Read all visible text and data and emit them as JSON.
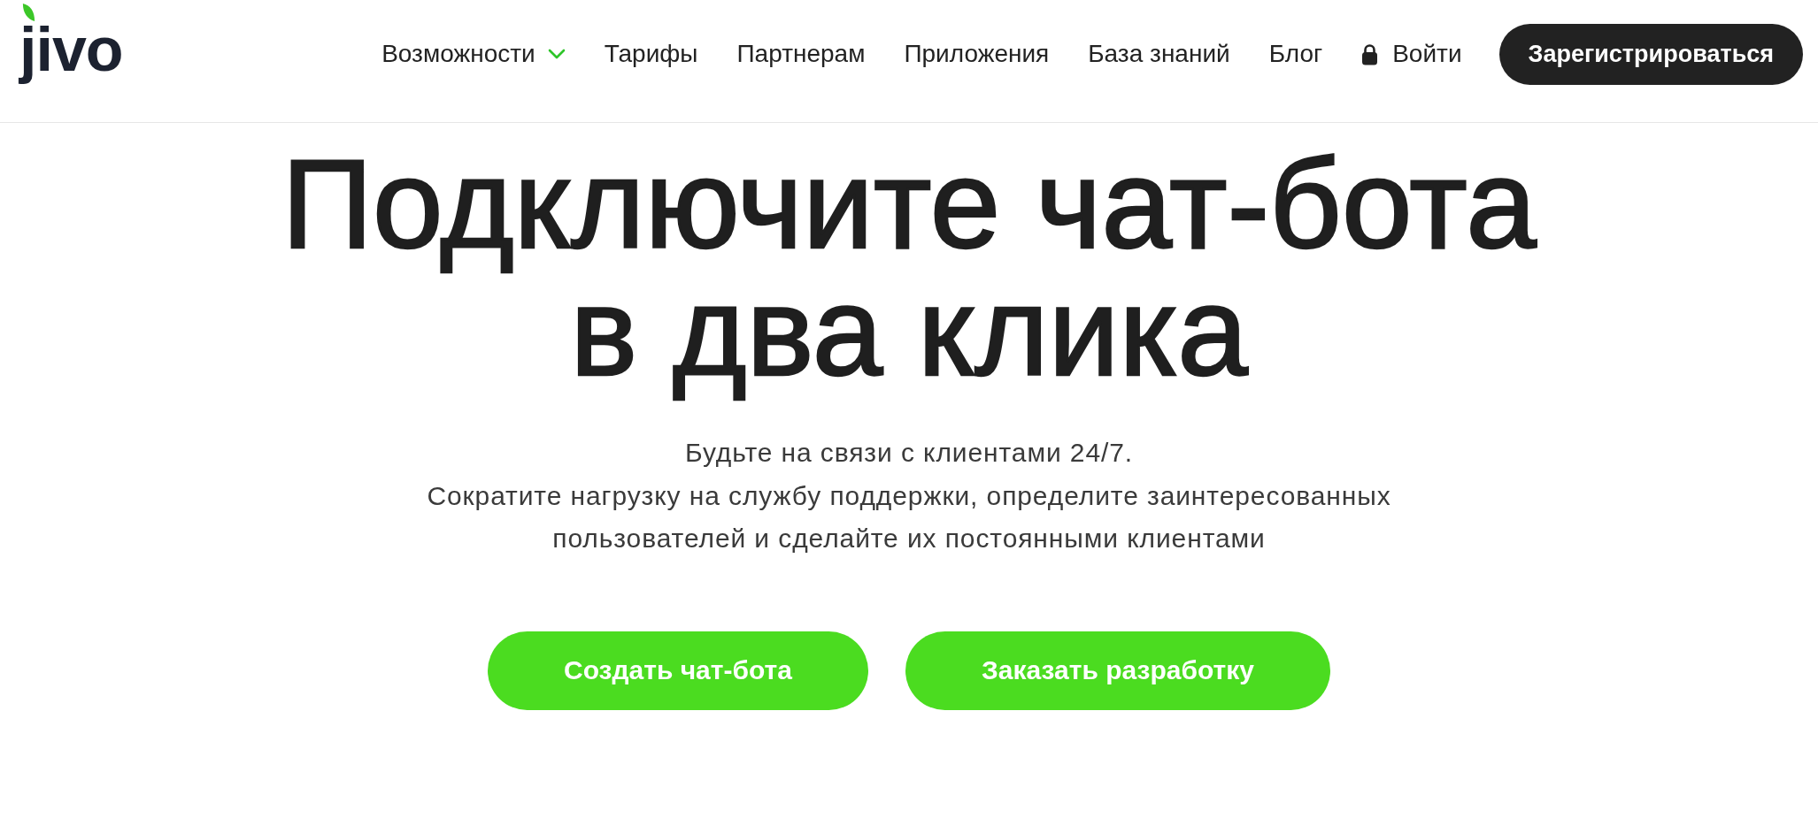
{
  "header": {
    "logo": "jivo",
    "nav": [
      {
        "kind": "dropdown",
        "label": "Возможности"
      },
      {
        "kind": "link",
        "label": "Тарифы"
      },
      {
        "kind": "link",
        "label": "Партнерам"
      },
      {
        "kind": "link",
        "label": "Приложения"
      },
      {
        "kind": "link",
        "label": "База знаний"
      },
      {
        "kind": "link",
        "label": "Блог"
      },
      {
        "kind": "login",
        "label": "Войти"
      }
    ],
    "signup_button": "Зарегистрироваться"
  },
  "hero": {
    "title_lines": [
      "Подключите чат-бота",
      "в два клика"
    ],
    "subtitle_lines": [
      "Будьте на связи с клиентами 24/7.",
      "Сократите нагрузку на службу поддержки, определите заинтересованных",
      "пользователей и сделайте их постоянными клиентами"
    ],
    "buttons": [
      "Создать чат-бота",
      "Заказать разработку"
    ]
  }
}
